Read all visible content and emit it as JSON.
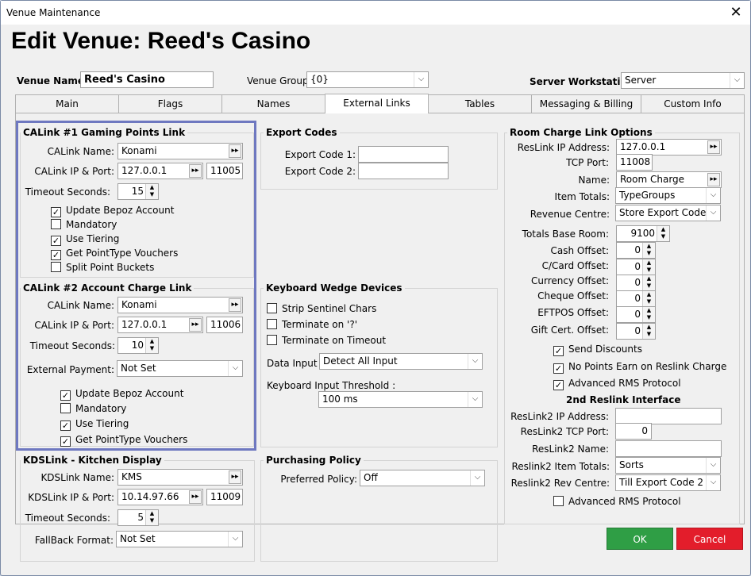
{
  "window": {
    "title": "Venue Maintenance",
    "close": "✕"
  },
  "heading": "Edit Venue: Reed's Casino",
  "top": {
    "venue_name_label": "Venue Name:",
    "venue_name_value": "Reed's Casino",
    "venue_group_label": "Venue Group:",
    "venue_group_value": "{0}",
    "server_ws_label": "Server Workstation:",
    "server_ws_value": "Server"
  },
  "tabs": [
    "Main",
    "Flags",
    "Names",
    "External Links",
    "Tables",
    "Messaging & Billing",
    "Custom Info"
  ],
  "calink1": {
    "title": "CALink #1 Gaming Points Link",
    "name_label": "CALink Name:",
    "name_value": "Konami",
    "ip_label": "CALink IP & Port:",
    "ip_value": "127.0.0.1",
    "port_value": "11005",
    "timeout_label": "Timeout Seconds:",
    "timeout_value": "15",
    "checks": [
      {
        "label": "Update Bepoz Account",
        "checked": "✓"
      },
      {
        "label": "Mandatory",
        "checked": ""
      },
      {
        "label": "Use Tiering",
        "checked": "✓"
      },
      {
        "label": "Get PointType Vouchers",
        "checked": "✓"
      },
      {
        "label": "Split Point Buckets",
        "checked": ""
      }
    ]
  },
  "calink2": {
    "title": "CALink #2 Account Charge Link",
    "name_label": "CALink Name:",
    "name_value": "Konami",
    "ip_label": "CALink IP & Port:",
    "ip_value": "127.0.0.1",
    "port_value": "11006",
    "timeout_label": "Timeout Seconds:",
    "timeout_value": "10",
    "ext_pay_label": "External Payment:",
    "ext_pay_value": "Not Set",
    "checks": [
      {
        "label": "Update Bepoz Account",
        "checked": "✓"
      },
      {
        "label": "Mandatory",
        "checked": ""
      },
      {
        "label": "Use Tiering",
        "checked": "✓"
      },
      {
        "label": "Get PointType Vouchers",
        "checked": "✓"
      }
    ]
  },
  "kds": {
    "title": "KDSLink - Kitchen Display",
    "name_label": "KDSLink Name:",
    "name_value": "KMS",
    "ip_label": "KDSLink IP & Port:",
    "ip_value": "10.14.97.66",
    "port_value": "11009",
    "timeout_label": "Timeout Seconds:",
    "timeout_value": "5",
    "fallback_label": "FallBack Format:",
    "fallback_value": "Not Set"
  },
  "export": {
    "title": "Export Codes",
    "code1_label": "Export Code 1:",
    "code1_value": "",
    "code2_label": "Export Code 2:",
    "code2_value": ""
  },
  "wedge": {
    "title": "Keyboard Wedge Devices",
    "checks": [
      {
        "label": "Strip Sentinel Chars",
        "checked": ""
      },
      {
        "label": "Terminate on '?'",
        "checked": ""
      },
      {
        "label": "Terminate on Timeout",
        "checked": ""
      }
    ],
    "data_input_label": "Data Input :",
    "data_input_value": "Detect All Input",
    "threshold_label": "Keyboard Input Threshold :",
    "threshold_value": "100 ms"
  },
  "purchasing": {
    "title": "Purchasing Policy",
    "policy_label": "Preferred Policy:",
    "policy_value": "Off"
  },
  "room": {
    "title": "Room Charge Link Options",
    "ip_label": "ResLink  IP Address:",
    "ip_value": "127.0.0.1",
    "tcp_label": "TCP Port:",
    "tcp_value": "11008",
    "name_label": "Name:",
    "name_value": "Room Charge",
    "item_totals_label": "Item Totals:",
    "item_totals_value": "TypeGroups",
    "revenue_label": "Revenue Centre:",
    "revenue_value": "Store Export Code 1",
    "base_room_label": "Totals Base Room:",
    "base_room_value": "9100",
    "offsets": [
      {
        "label": "Cash Offset:",
        "value": "0"
      },
      {
        "label": "C/Card Offset:",
        "value": "0"
      },
      {
        "label": "Currency Offset:",
        "value": "0"
      },
      {
        "label": "Cheque Offset:",
        "value": "0"
      },
      {
        "label": "EFTPOS Offset:",
        "value": "0"
      },
      {
        "label": "Gift Cert. Offset:",
        "value": "0"
      }
    ],
    "checks": [
      {
        "label": "Send Discounts",
        "checked": "✓"
      },
      {
        "label": "No Points Earn on Reslink Charge",
        "checked": "✓"
      },
      {
        "label": "Advanced RMS Protocol",
        "checked": "✓"
      }
    ],
    "second_title": "2nd Reslink Interface",
    "r2_ip_label": "ResLink2  IP Address:",
    "r2_ip_value": "",
    "r2_tcp_label": "ResLink2 TCP Port:",
    "r2_tcp_value": "0",
    "r2_name_label": "ResLink2 Name:",
    "r2_name_value": "",
    "r2_item_label": "Reslink2 Item Totals:",
    "r2_item_value": "Sorts",
    "r2_rev_label": "Reslink2 Rev Centre:",
    "r2_rev_value": "Till Export Code 2",
    "r2_adv_label": "Advanced RMS Protocol",
    "r2_adv_checked": ""
  },
  "buttons": {
    "ok": "OK",
    "cancel": "Cancel"
  },
  "icons": {
    "dropdown": "⌵",
    "browse": "▸▸",
    "spin_up": "▲",
    "spin_down": "▼"
  },
  "colors": {
    "ok": "#2f9e45",
    "cancel": "#e31d2b",
    "highlight": "#6e78c0"
  }
}
